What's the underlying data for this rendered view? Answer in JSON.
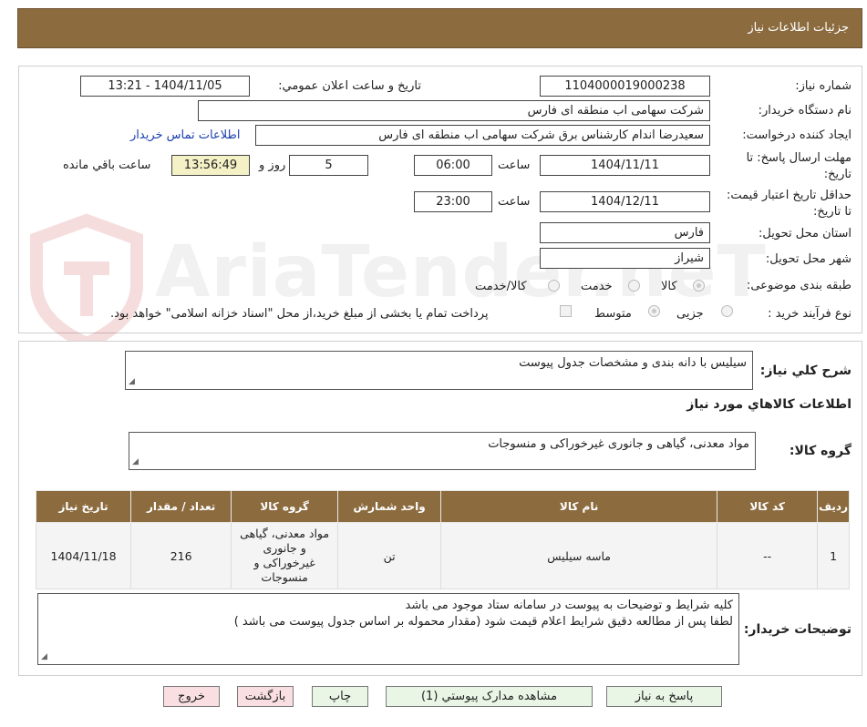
{
  "header": {
    "title": "جزئیات اطلاعات نیاز"
  },
  "watermark": {
    "text": "AriaTender.neT"
  },
  "form": {
    "need_number": {
      "label": "شماره نیاز:",
      "value": "1104000019000238"
    },
    "announce": {
      "label": "تاریخ و ساعت اعلان عمومي:",
      "value": "1404/11/05 - 13:21"
    },
    "buyer_org": {
      "label": "نام دستگاه خریدار:",
      "value": "شرکت سهامی اب منطقه ای فارس"
    },
    "requester": {
      "label": "ایجاد کننده درخواست:",
      "value": "سعیدرضا اندام کارشناس برق شرکت سهامی اب منطقه ای فارس",
      "contact_link": "اطلاعات تماس خریدار"
    },
    "deadline": {
      "label": "مهلت ارسال پاسخ: تا تاریخ:",
      "date": "1404/11/11",
      "time_label": "ساعت",
      "time": "06:00",
      "days": "5",
      "days_label": "روز و",
      "remaining": "13:56:49",
      "remaining_label": "ساعت باقي مانده"
    },
    "validity": {
      "label": "حداقل تاریخ اعتبار قیمت: تا تاریخ:",
      "date": "1404/12/11",
      "time_label": "ساعت",
      "time": "23:00"
    },
    "province": {
      "label": "استان محل تحویل:",
      "value": "فارس"
    },
    "city": {
      "label": "شهر محل تحویل:",
      "value": "شیراز"
    },
    "category": {
      "label": "طبقه بندی موضوعی:",
      "options": [
        "کالا",
        "خدمت",
        "کالا/خدمت"
      ],
      "selected": "کالا"
    },
    "process": {
      "label": "نوع فرآیند خرید :",
      "options": [
        "جزیی",
        "متوسط"
      ],
      "selected": "متوسط",
      "payment_note": "پرداخت تمام یا بخشی از مبلغ خرید،از محل \"اسناد خزانه اسلامی\" خواهد بود."
    }
  },
  "summary": {
    "label": "شرح کلي نياز:",
    "value": "سیلیس با دانه بندی و مشخصات جدول پیوست",
    "goods_info_title": "اطلاعات کالاهاي مورد نياز",
    "group_label": "گروه کالا:",
    "group_value": "مواد معدنی، گیاهی و جانوری غیرخوراکی و منسوجات"
  },
  "items_table": {
    "columns": [
      "ردیف",
      "کد کالا",
      "نام کالا",
      "واحد شمارش",
      "گروه کالا",
      "تعداد / مقدار",
      "تاریخ نیاز"
    ],
    "rows": [
      [
        "1",
        "--",
        "ماسه سیلیس",
        "تن",
        "مواد معدنی، گیاهی و جانوری غیرخوراکی و منسوجات",
        "216",
        "1404/11/18"
      ]
    ]
  },
  "buyer_notes": {
    "label": "توضیحات خریدار:",
    "line1": "کلیه شرایط و توضیحات به پیوست در سامانه ستاد موجود می باشد",
    "line2": "لطفا پس از مطالعه دقیق شرایط اعلام قیمت شود (مقدار محموله بر اساس جدول پیوست می باشد )"
  },
  "buttons": {
    "reply": "پاسخ به نیاز",
    "attachments": "مشاهده مدارک پیوستي (1)",
    "print": "چاپ",
    "back": "بازگشت",
    "exit": "خروج"
  },
  "colors": {
    "header_bg": "#8c6c3f",
    "link": "#1a3fb0",
    "button_green": "#e9f6e6",
    "button_red": "#f9dfe1",
    "timer_bg": "#f5f1c6"
  }
}
